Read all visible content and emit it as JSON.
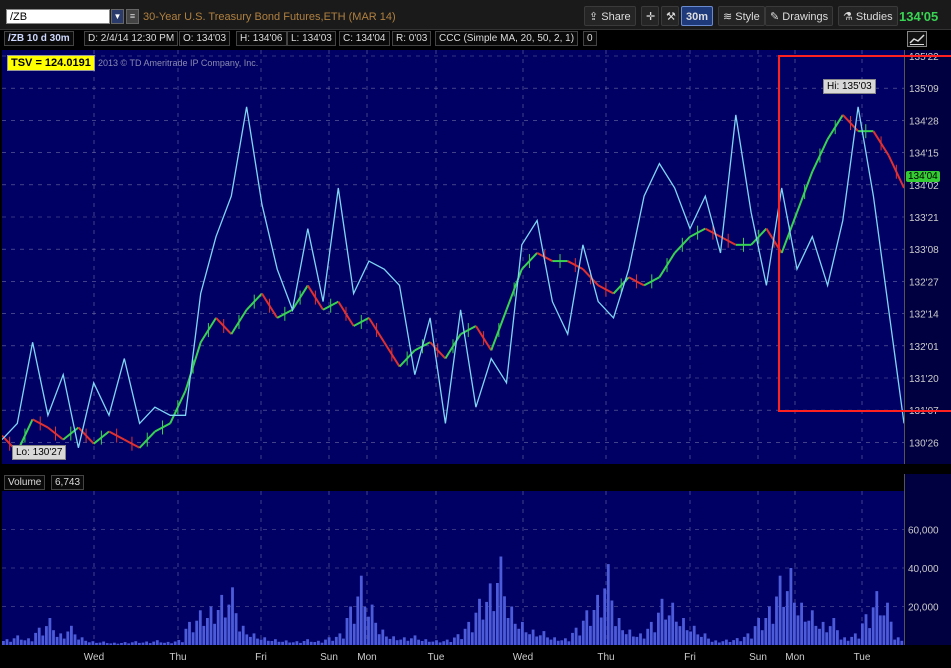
{
  "toolbar": {
    "symbol": "/ZB",
    "description": "30-Year U.S. Treasury Bond Futures,ETH (MAR 14)",
    "share_label": "Share",
    "timeframe_label": "30m",
    "style_label": "Style",
    "drawings_label": "Drawings",
    "studies_label": "Studies",
    "last_price": "134'05"
  },
  "info": {
    "symbol_label": "/ZB 10 d 30m",
    "date": "D: 2/4/14 12:30 PM",
    "open": "O: 134'03",
    "high": "H: 134'06",
    "low": "L: 134'03",
    "close": "C: 134'04",
    "range": "R: 0'03",
    "study": "CCC (Simple MA, 20, 50, 2, 1)",
    "study_value": "0"
  },
  "overlay": {
    "tsv_label": "TSV  = 124.0191",
    "copyright": "2013 © TD Ameritrade IP Company, Inc.",
    "hi_label": "Hi: 135'03",
    "lo_label": "Lo: 130'27",
    "current_tag": "134'04"
  },
  "volume_panel": {
    "label": "Volume",
    "value": "6,743"
  },
  "colors": {
    "plot_bg": "#000064",
    "study_line": "#7fd6f5",
    "candle_up": "#39d353",
    "candle_down": "#e03030",
    "volume_bar": "#4b5bd9",
    "highlight_box": "#ff2020"
  },
  "chart_data": [
    {
      "type": "line",
      "title": "/ZB 10 d 30m",
      "y_ticks": [
        "135'22",
        "135'09",
        "134'28",
        "134'15",
        "134'02",
        "133'21",
        "133'08",
        "132'27",
        "132'14",
        "132'01",
        "131'20",
        "131'07",
        "130'26"
      ],
      "x_ticks": [
        "Wed",
        "Thu",
        "Fri",
        "Sun",
        "Mon",
        "Tue",
        "Wed",
        "Thu",
        "Fri",
        "Sun",
        "Mon",
        "Tue"
      ],
      "ylim": [
        130.7,
        135.8
      ],
      "grid": true,
      "series": [
        {
          "name": "/ZB",
          "y": [
            131.05,
            130.85,
            131.25,
            131.15,
            131.0,
            131.15,
            130.95,
            131.1,
            131.0,
            130.9,
            131.1,
            131.2,
            131.6,
            132.2,
            132.5,
            132.3,
            132.6,
            132.8,
            132.5,
            132.6,
            132.9,
            132.6,
            132.7,
            132.4,
            132.5,
            132.2,
            131.9,
            132.1,
            132.2,
            132.0,
            132.3,
            132.4,
            132.1,
            132.6,
            133.1,
            133.3,
            133.2,
            133.2,
            133.1,
            132.9,
            132.8,
            133.0,
            132.9,
            133.0,
            133.3,
            133.5,
            133.6,
            133.5,
            133.4,
            133.4,
            133.6,
            133.3,
            133.8,
            134.3,
            134.7,
            135.0,
            134.8,
            134.8,
            134.5,
            134.1
          ]
        },
        {
          "name": "CCC",
          "y": [
            131.0,
            131.2,
            132.2,
            131.3,
            131.8,
            130.9,
            131.7,
            131.3,
            132.0,
            131.2,
            131.4,
            131.3,
            131.3,
            132.8,
            133.5,
            134.0,
            135.1,
            133.9,
            133.1,
            132.6,
            133.6,
            132.7,
            134.1,
            132.8,
            133.2,
            133.1,
            132.9,
            131.8,
            132.5,
            131.2,
            132.6,
            131.4,
            132.0,
            131.7,
            133.4,
            133.7,
            132.7,
            132.3,
            133.4,
            132.7,
            132.5,
            133.1,
            134.0,
            134.4,
            134.1,
            133.6,
            134.0,
            133.3,
            135.0,
            133.8,
            132.9,
            134.1,
            133.1,
            133.5,
            132.9,
            133.7,
            135.1,
            134.0,
            132.6,
            131.2
          ]
        }
      ]
    },
    {
      "type": "bar",
      "title": "Volume",
      "y_ticks": [
        "60,000",
        "40,000",
        "20,000"
      ],
      "ylim": [
        0,
        80000
      ],
      "values": [
        3000,
        5000,
        3500,
        9000,
        14000,
        6000,
        10000,
        4000,
        2000,
        1800,
        1200,
        1500,
        2000,
        1800,
        2500,
        1600,
        2600,
        12000,
        18000,
        20000,
        26000,
        30000,
        10000,
        6000,
        4000,
        3000,
        2400,
        2000,
        3000,
        2200,
        4000,
        6000,
        20000,
        36000,
        21000,
        8000,
        4500,
        4000,
        5000,
        3000,
        2500,
        2800,
        5600,
        12000,
        24000,
        32000,
        46000,
        20000,
        12000,
        8000,
        7200,
        4000,
        3500,
        9000,
        18000,
        26000,
        42000,
        14000,
        8000,
        6000,
        12000,
        24000,
        22000,
        14000,
        10000,
        6000,
        2400,
        2800,
        3600,
        6000,
        14000,
        20000,
        36000,
        40000,
        22000,
        18000,
        12000,
        14000,
        4000,
        6000,
        16000,
        28000,
        22000,
        4000
      ]
    }
  ]
}
